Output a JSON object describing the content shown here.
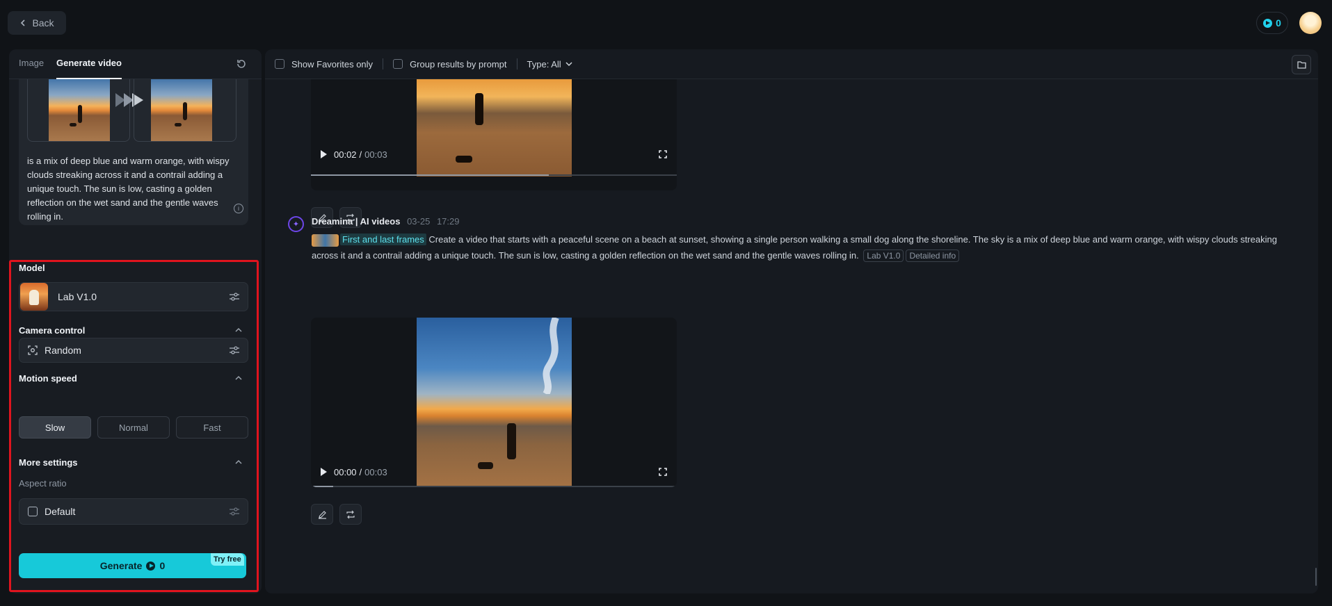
{
  "topbar": {
    "back_label": "Back",
    "credits": "0"
  },
  "left": {
    "tabs": [
      "Image",
      "Generate video"
    ],
    "prompt_text": "is a mix of deep blue and warm orange, with wispy clouds streaking across it and a contrail adding a unique touch. The sun is low, casting a golden reflection on the wet sand and the gentle waves rolling in.",
    "model_label": "Model",
    "model_value": "Lab V1.0",
    "camera_label": "Camera control",
    "camera_value": "Random",
    "motion_label": "Motion speed",
    "speeds": [
      "Slow",
      "Normal",
      "Fast"
    ],
    "selected_speed": "Slow",
    "more_label": "More settings",
    "aspect_label": "Aspect ratio",
    "aspect_value": "Default",
    "generate_label": "Generate",
    "generate_cost": "0",
    "try_free": "Try free"
  },
  "filters": {
    "favorites": "Show Favorites only",
    "group": "Group results by prompt",
    "type": "Type: All"
  },
  "video1": {
    "current": "00:02",
    "total": "00:03",
    "progress": 0.65
  },
  "generation": {
    "author": "Dreamina | AI videos",
    "date": "03-25",
    "time": "17:29",
    "frames_tag": "First and last frames",
    "prompt": "Create a video that starts with a peaceful scene on a beach at sunset, showing a single person walking a small dog along the shoreline. The sky is a mix of deep blue and warm orange, with wispy clouds streaking across it and a contrail adding a unique touch. The sun is low, casting a golden reflection on the wet sand and the gentle waves rolling in.",
    "model_tag": "Lab V1.0",
    "info_tag": "Detailed info"
  },
  "video2": {
    "current": "00:00",
    "total": "00:03",
    "progress": 0.06
  },
  "colors": {
    "accent": "#17c9d9",
    "highlight": "#e0141e",
    "brand": "#6d46e8"
  }
}
